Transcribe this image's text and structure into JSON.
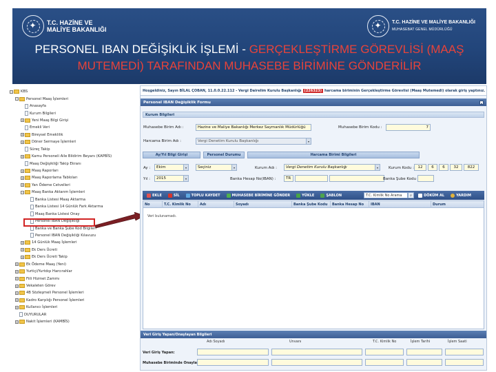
{
  "banner": {
    "logo_left_line1": "T.C. HAZİNE VE",
    "logo_left_line2": "MALİYE BAKANLIĞI",
    "logo_right_line1": "T.C. HAZİNE VE MALİYE BAKANLIĞI",
    "logo_right_line2": "MUHASEBAT GENEL MÜDÜRLÜĞÜ",
    "title_white": "PERSONEL IBAN DEĞİŞİKLİK İŞLEMİ - ",
    "title_red": "GERÇEKLEŞTİRME GÖREVLİSİ (MAAŞ MUTEMEDİ) TARAFINDAN MUHASEBE BİRİMİNE GÖNDERİLİR",
    "colors": {
      "banner": "#22457a",
      "title_white": "#ffffff",
      "title_red": "#e8433a"
    }
  },
  "tree": {
    "items": [
      {
        "label": "KBS",
        "indent": 0,
        "toggle": "−",
        "icon": "folder"
      },
      {
        "label": "Personel Maaş İşlemleri",
        "indent": 1,
        "toggle": "−",
        "icon": "folder"
      },
      {
        "label": "Anasayfa",
        "indent": 2,
        "toggle": "",
        "icon": "page"
      },
      {
        "label": "Kurum Bilgileri",
        "indent": 2,
        "toggle": "",
        "icon": "page"
      },
      {
        "label": "Yeni Maaş Bilgi Girişi",
        "indent": 2,
        "toggle": "+",
        "icon": "folder"
      },
      {
        "label": "Emekli Veri",
        "indent": 2,
        "toggle": "",
        "icon": "page"
      },
      {
        "label": "Bireysel Emeklilik",
        "indent": 2,
        "toggle": "+",
        "icon": "folder"
      },
      {
        "label": "Döner Sermaye İşlemleri",
        "indent": 2,
        "toggle": "+",
        "icon": "folder"
      },
      {
        "label": "Süreç Takip",
        "indent": 2,
        "toggle": "",
        "icon": "page"
      },
      {
        "label": "Kamu Personeli Aile Bildirim Beyanı (KAPBİS)",
        "indent": 2,
        "toggle": "+",
        "icon": "folder"
      },
      {
        "label": "Maaş Değişikliği Takip Ekranı",
        "indent": 2,
        "toggle": "",
        "icon": "page"
      },
      {
        "label": "Maaş Raporları",
        "indent": 2,
        "toggle": "+",
        "icon": "folder"
      },
      {
        "label": "Maaş Raporlama Tabloları",
        "indent": 2,
        "toggle": "+",
        "icon": "folder"
      },
      {
        "label": "Yan Ödeme Cetvelleri",
        "indent": 2,
        "toggle": "+",
        "icon": "folder"
      },
      {
        "label": "Maaş Banka Aktarım İşlemleri",
        "indent": 2,
        "toggle": "−",
        "icon": "folder"
      },
      {
        "label": "Banka Listesi Maaş Aktarma",
        "indent": 3,
        "toggle": "",
        "icon": "page"
      },
      {
        "label": "Banka Listesi 14 Günlük Fark Aktarma",
        "indent": 3,
        "toggle": "",
        "icon": "page"
      },
      {
        "label": "Maaş Banka Listesi Onay",
        "indent": 3,
        "toggle": "",
        "icon": "page"
      },
      {
        "label": "Personel IBAN Değişikliği",
        "indent": 3,
        "toggle": "",
        "icon": "page",
        "selected": true
      },
      {
        "label": "Banka ve Banka Şube Kod Bilgileri",
        "indent": 3,
        "toggle": "",
        "icon": "page"
      },
      {
        "label": "Personel IBAN Değişikliği Kılavuzu",
        "indent": 3,
        "toggle": "",
        "icon": "page"
      },
      {
        "label": "14 Günlük Maaş İşlemleri",
        "indent": 2,
        "toggle": "+",
        "icon": "folder"
      },
      {
        "label": "Ek Ders Ücreti",
        "indent": 2,
        "toggle": "+",
        "icon": "folder"
      },
      {
        "label": "Ek Ders Ücreti Takip",
        "indent": 2,
        "toggle": "+",
        "icon": "folder"
      },
      {
        "label": "Ek Ödeme Maaş (Yeni)",
        "indent": 1,
        "toggle": "+",
        "icon": "folder"
      },
      {
        "label": "Yurtiçi/Yurtdışı Harcırahlar",
        "indent": 1,
        "toggle": "+",
        "icon": "folder"
      },
      {
        "label": "Fiili Hizmet Zammı",
        "indent": 1,
        "toggle": "+",
        "icon": "folder"
      },
      {
        "label": "Vekaleten Görev",
        "indent": 1,
        "toggle": "+",
        "icon": "folder"
      },
      {
        "label": "4B Sözleşmeli Personel İşlemleri",
        "indent": 1,
        "toggle": "+",
        "icon": "folder"
      },
      {
        "label": "Kadro Karşılığı Personel İşlemleri",
        "indent": 1,
        "toggle": "+",
        "icon": "folder"
      },
      {
        "label": "Kullanıcı İşlemleri",
        "indent": 1,
        "toggle": "+",
        "icon": "folder"
      },
      {
        "label": "DUYURULAR",
        "indent": 1,
        "toggle": "",
        "icon": "page"
      },
      {
        "label": "Nakit İşlemleri (KAMBİS)",
        "indent": 1,
        "toggle": "+",
        "icon": "folder"
      }
    ]
  },
  "main": {
    "welcome_pre": "Hoşgeldiniz, Sayın BİLAL ÇOBAN, 11.0.0.22.112 - Vergi Dairelim Kurulu Başkanlığı",
    "welcome_code": "(226323)",
    "welcome_post": "harcama biriminin Gerçekleştirme Görevlisi (Maaş Mutemedi) olarak giriş yaptınız.",
    "form_title": "Personel IBAN Değişiklik Formu",
    "kurum_head": "Kurum Bilgileri",
    "muhasebe_label": "Muhasebe Birim Adı :",
    "muhasebe_value": "Hazine ve Maliye Bakanlığı Merkez Saymanlık Müdürlüğü",
    "muhasebe_kod_label": "Muhasebe Birim Kodu :",
    "muhasebe_kod_value": "7",
    "harcama_label": "Harcama Birim Adı :",
    "harcama_value": "Vergi Denetim Kurulu Başkanlığı",
    "tabs": [
      "Ay/Yıl Bilgi Girişi",
      "Personel Durumu",
      "Harcama Birimi Bilgileri"
    ],
    "ay_label": "Ay :",
    "ay_value": "Ekim",
    "yil_label": "Yıl :",
    "yil_value": "2015",
    "durum_value": "Seçiniz",
    "kurum_adi_label": "Kurum Adı :",
    "kurum_adi_value": "Vergi Denetim Kurulu Başkanlığı",
    "kurum_kodu_label": "Kurum Kodu :",
    "kurum_kodu_values": [
      "12",
      "6",
      "6",
      "32",
      "822"
    ],
    "banka_hesap_label": "Banka Hesap No(IBAN) :",
    "iban_prefix": "TR",
    "banka_sube_label": "Banka Şube Kodu :",
    "toolbar": {
      "ekle": "EKLE",
      "sil": "SİL",
      "toplu_kaydet": "TOPLU KAYDET",
      "muhasebe_gonder": "MUHASEBE BİRİMİNE GÖNDER",
      "yukle": "YÜKLE",
      "sablon": "ŞABLON",
      "search_placeholder": "T.C. Kimlik No Arama",
      "dokum_al": "DÖKÜM AL",
      "yardim": "YARDIM"
    },
    "grid_columns": [
      "No",
      "T.C. Kimlik No",
      "Adı",
      "Soyadı",
      "Banka Şube Kodu",
      "Banka Hesap No",
      "IBAN",
      "Durum"
    ],
    "empty_message": "Veri bulunamadı.",
    "bottom_title": "Veri Giriş Yapan/Onaylayan Bilgileri",
    "bottom_columns": [
      "Adı Soyadı",
      "Unvanı",
      "T.C. Kimlik No",
      "İşlem Tarihi",
      "İşlem Saati"
    ],
    "veri_giris_label": "Veri Giriş Yapan:",
    "muhasebe_onay_label": "Muhasebe Biriminde Onaylayan:"
  }
}
